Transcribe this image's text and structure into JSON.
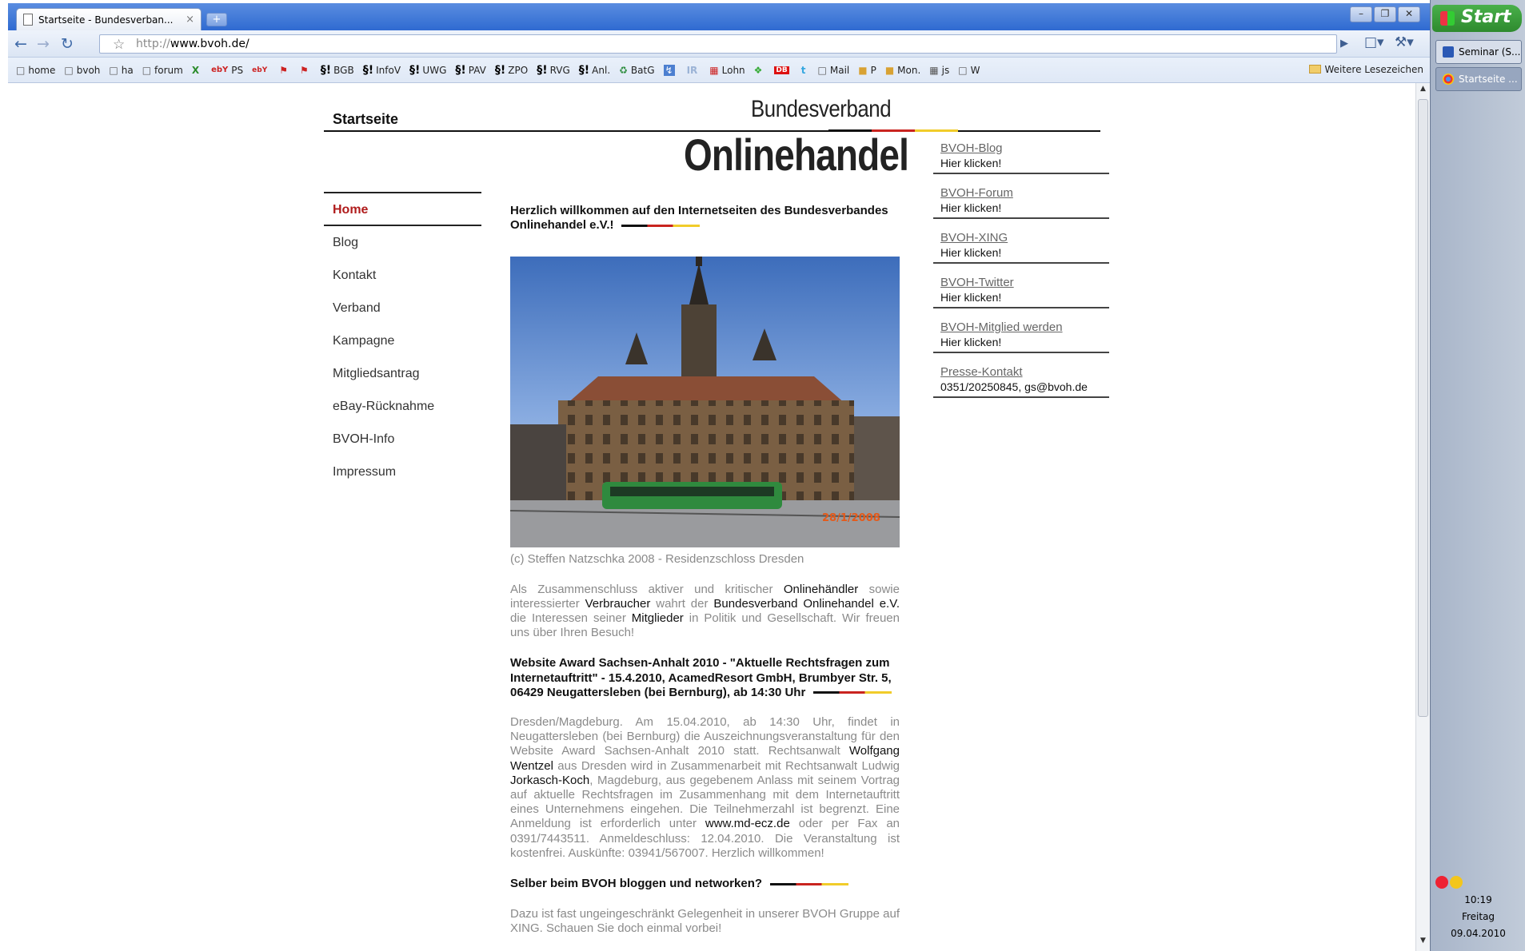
{
  "browser": {
    "tab_title": "Startseite - Bundesverban...",
    "tab_close": "×",
    "new_tab": "+",
    "url_scheme": "http://",
    "url_host": "www.bvoh.de/",
    "win_min": "–",
    "win_max": "❐",
    "win_close": "✕",
    "bookmarks": [
      "home",
      "bvoh",
      "ha",
      "forum",
      "",
      "PS",
      "",
      "",
      "",
      "BGB",
      "InfoV",
      "UWG",
      "PAV",
      "ZPO",
      "RVG",
      "Anl.",
      "BatG",
      "",
      "",
      "Lohn",
      "",
      "",
      "",
      "Mail",
      "P",
      "Mon.",
      "js",
      "W"
    ],
    "other_bookmarks": "Weitere Lesezeichen"
  },
  "taskbar": {
    "start_label": "Start",
    "tasks": [
      "Seminar (S...",
      "Startseite ..."
    ],
    "time": "10:19",
    "weekday": "Freitag",
    "date": "09.04.2010"
  },
  "site": {
    "page_title": "Startseite",
    "logo_top": "Bundesverband",
    "logo_main": "Onlinehandel",
    "nav": [
      "Home",
      "Blog",
      "Kontakt",
      "Verband",
      "Kampagne",
      "Mitgliedsantrag",
      "eBay-Rücknahme",
      "BVOH-Info",
      "Impressum"
    ],
    "welcome_heading": "Herzlich willkommen auf den Internetseiten des Bundesverbandes Onlinehandel e.V.!",
    "photo_stamp": "28/1/2008",
    "photo_caption": "(c) Steffen Natzschka 2008 - Residenzschloss Dresden",
    "intro": {
      "t1": "Als Zusammenschluss aktiver und kritischer ",
      "l1": "Onlinehändler",
      "t2": " sowie interessierter ",
      "l2": "Verbraucher",
      "t3": " wahrt der ",
      "l3": "Bundesverband Onlinehandel e.V.",
      "t4": " die Interessen seiner ",
      "l4": "Mitglieder",
      "t5": " in Politik und Gesellschaft. Wir freuen uns über Ihren Besuch!"
    },
    "award_heading": "Website Award Sachsen-Anhalt 2010 - \"Aktuelle Rechtsfragen zum Internetauftritt\" - 15.4.2010, AcamedResort GmbH, Brumbyer Str. 5, 06429 Neugattersleben (bei Bernburg), ab 14:30 Uhr",
    "award": {
      "t1": "Dresden/Magdeburg. Am 15.04.2010, ab 14:30 Uhr, findet in Neugattersleben (bei Bernburg) die Auszeichnungsveranstaltung für den Website Award Sachsen-Anhalt 2010 statt. Rechtsanwalt ",
      "l1": "Wolfgang Wentzel",
      "t2": " aus Dresden wird in Zusammenarbeit mit Rechtsanwalt Ludwig ",
      "l2": "Jorkasch-Koch",
      "t3": ", Magdeburg, aus gegebenem Anlass mit seinem Vortrag auf aktuelle Rechtsfragen im Zusammenhang mit dem Internetauftritt eines Unternehmens eingehen. Die Teilnehmerzahl ist begrenzt. Eine Anmeldung ist erforderlich unter ",
      "l3": "www.md-ecz.de",
      "t4": "  oder per Fax an 0391/7443511. Anmeldeschluss: 12.04.2010. Die Veranstaltung ist kostenfrei. Auskünfte: 03941/567007. Herzlich willkommen!"
    },
    "blog_heading": "Selber beim BVOH bloggen und networken?",
    "blog_text": "Dazu ist fast ungeingeschränkt Gelegenheit in unserer BVOH Gruppe auf XING. Schauen Sie doch einmal vorbei!",
    "right_boxes": [
      {
        "link": "BVOH-Blog",
        "sub": "Hier klicken!"
      },
      {
        "link": "BVOH-Forum",
        "sub": "Hier klicken!"
      },
      {
        "link": "BVOH-XING",
        "sub": "Hier klicken!"
      },
      {
        "link": "BVOH-Twitter",
        "sub": "Hier klicken!"
      },
      {
        "link": "BVOH-Mitglied werden",
        "sub": "Hier klicken!"
      },
      {
        "link": "Presse-Kontakt",
        "sub": "0351/20250845, gs@bvoh.de"
      }
    ]
  },
  "colors": {
    "nav_active": "#b01c1c",
    "flag_black": "#111111",
    "flag_red": "#c9241f",
    "flag_gold": "#f1cc2a"
  }
}
